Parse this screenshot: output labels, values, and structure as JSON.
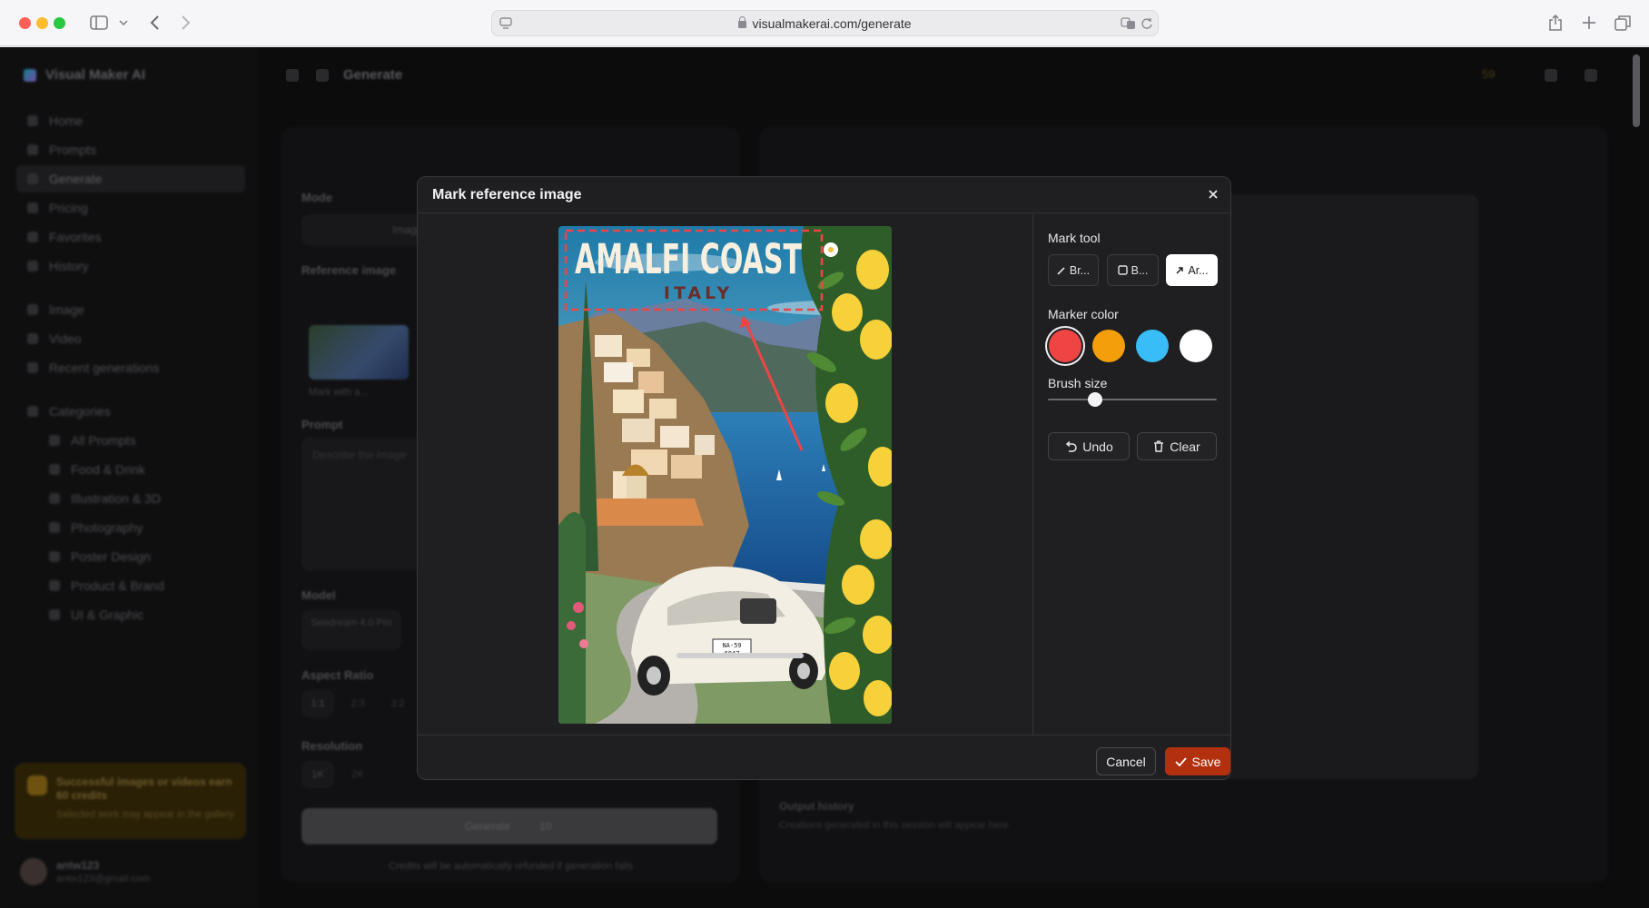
{
  "browser": {
    "url": "visualmakerai.com/generate",
    "icons": [
      "sidebar-icon",
      "chevron-down-icon",
      "back-icon",
      "forward-icon",
      "translate-icon",
      "reload-icon",
      "share-icon",
      "new-tab-icon",
      "tabs-overview-icon"
    ]
  },
  "app": {
    "brand": "Visual Maker AI",
    "page_title": "Generate",
    "credits": "59",
    "nav": [
      {
        "label": "Home"
      },
      {
        "label": "Prompts"
      },
      {
        "label": "Generate",
        "active": true
      },
      {
        "label": "Pricing"
      },
      {
        "label": "Favorites"
      },
      {
        "label": "History"
      }
    ],
    "nav2": [
      {
        "label": "Image"
      },
      {
        "label": "Video"
      },
      {
        "label": "Recent generations"
      }
    ],
    "categories_label": "Categories",
    "categories": [
      {
        "label": "All Prompts"
      },
      {
        "label": "Food & Drink"
      },
      {
        "label": "Illustration & 3D"
      },
      {
        "label": "Photography"
      },
      {
        "label": "Poster Design"
      },
      {
        "label": "Product & Brand"
      },
      {
        "label": "UI & Graphic"
      }
    ],
    "promo": {
      "line1": "Successful images or videos earn 60 credits",
      "line2": "Selected work may appear in the gallery"
    },
    "user": {
      "name": "antw123",
      "email": "antw123@gmail.com"
    },
    "left_panel": {
      "mode_label": "Mode",
      "mode_selected": "Image",
      "reference_label": "Reference image",
      "mark_button": "Mark with a...",
      "prompt_label": "Prompt",
      "prompt_placeholder": "Describe the image",
      "model_label": "Model",
      "model_value": "Seedream 4.0 Pro",
      "aspect_label": "Aspect Ratio",
      "aspect_options": [
        "1:1",
        "2:3",
        "3:2"
      ],
      "resolution_label": "Resolution",
      "resolution_options": [
        "1K",
        "2K"
      ],
      "generate_label": "Generate",
      "generate_cost": "10",
      "caption": "Credits will be automatically refunded if generation fails"
    },
    "right_panel": {
      "title": "Output history",
      "subtitle": "Creations generated in this session will appear here"
    }
  },
  "modal": {
    "title": "Mark reference image",
    "close_icon": "close-icon",
    "poster": {
      "headline": "AMALFI COAST",
      "subhead": "ITALY",
      "plate_line1": "NA-59",
      "plate_line2": "6847"
    },
    "mark_tool_label": "Mark tool",
    "tools": [
      {
        "label": "Br...",
        "icon": "pencil-icon"
      },
      {
        "label": "B...",
        "icon": "box-icon"
      },
      {
        "label": "Ar...",
        "icon": "arrow-icon",
        "selected": true
      }
    ],
    "marker_color_label": "Marker color",
    "colors": [
      {
        "name": "red",
        "hex": "#ef4444",
        "selected": true
      },
      {
        "name": "orange",
        "hex": "#f59e0b"
      },
      {
        "name": "cyan",
        "hex": "#38bdf8"
      },
      {
        "name": "white",
        "hex": "#ffffff"
      }
    ],
    "brush_size_label": "Brush size",
    "brush_size_fraction": 0.28,
    "undo_label": "Undo",
    "clear_label": "Clear",
    "cancel_label": "Cancel",
    "save_label": "Save"
  }
}
